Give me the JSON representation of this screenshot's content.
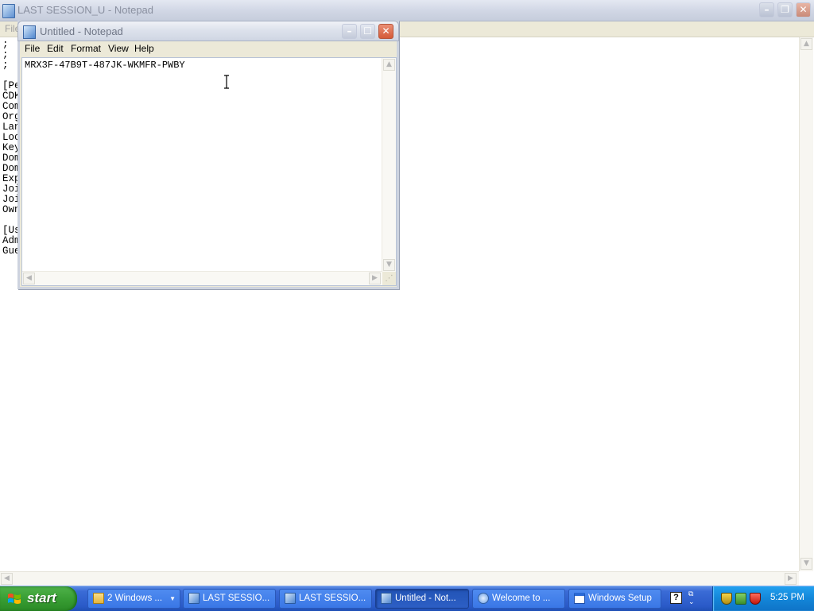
{
  "background_window": {
    "title": "LAST SESSION_U - Notepad",
    "menu_first": "File",
    "text_lines": [
      ";",
      ";",
      ";",
      "",
      "[Pe",
      "CDK",
      "Com",
      "Org",
      "Lan",
      "Loc",
      "Key",
      "Dom",
      "Dom",
      "Exp",
      "Joi",
      "Joi",
      "Own",
      "",
      "[Us",
      "Adm",
      "Gue"
    ]
  },
  "notepad": {
    "title": "Untitled - Notepad",
    "menu": [
      "File",
      "Edit",
      "Format",
      "View",
      "Help"
    ],
    "content": "MRX3F-47B9T-487JK-WKMFR-PWBY"
  },
  "taskbar": {
    "start_label": "start",
    "buttons": [
      {
        "label": "2 Windows ...",
        "icon": "folder-icon"
      },
      {
        "label": "LAST SESSIO...",
        "icon": "notepad-icon"
      },
      {
        "label": "LAST SESSIO...",
        "icon": "notepad-icon"
      },
      {
        "label": "Untitled - Not...",
        "icon": "notepad-icon",
        "active": true
      },
      {
        "label": "Welcome to ...",
        "icon": "welcome-icon"
      },
      {
        "label": "Windows Setup",
        "icon": "window-icon"
      }
    ],
    "help_glyph": "?",
    "clock": "5:25 PM"
  },
  "colors": {
    "taskbar_blue": "#2a5ac8",
    "start_green": "#379c32",
    "tray_blue": "#1386d8",
    "close_red": "#d55a37"
  }
}
